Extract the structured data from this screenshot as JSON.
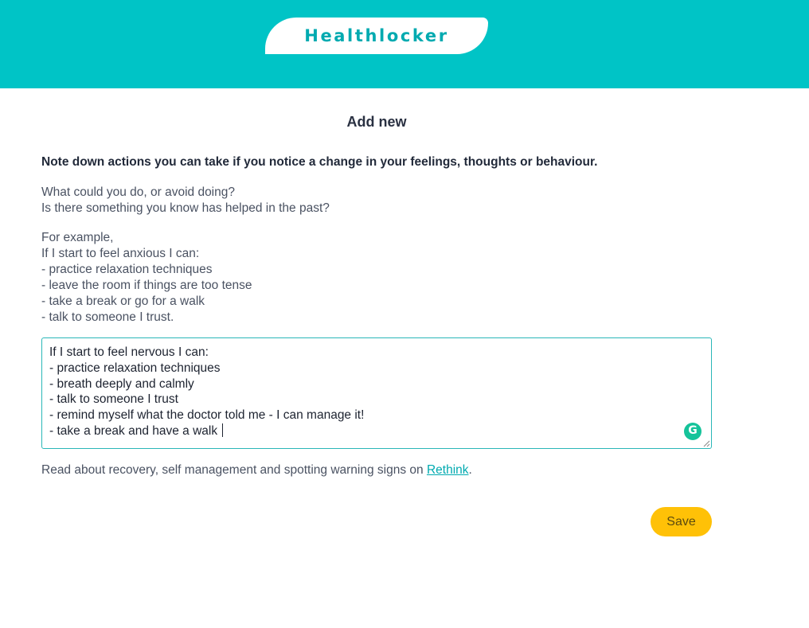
{
  "header": {
    "logo_text": "Healthlocker",
    "background_color": "#00c4c6"
  },
  "main": {
    "title": "Add new",
    "intro": "Note down actions you can take if you notice a change in your feelings, thoughts or behaviour.",
    "questions": [
      "What could you do, or avoid doing?",
      "Is there something you know has helped in the past?"
    ],
    "example": [
      "For example,",
      "If I start to feel anxious I can:",
      "- practice relaxation techniques",
      "- leave the room if things are too tense",
      "- take a break or go for a walk",
      "- talk to someone I trust."
    ],
    "editor": {
      "lines": [
        "If I start to feel nervous I can:",
        "- practice relaxation techniques",
        "- breath deeply and calmly",
        "- talk to someone I trust",
        "- remind myself what the doctor told me - I can manage it!",
        "- take a break and have a walk "
      ],
      "grammarly_badge": "G",
      "border_color": "#2ab7b8"
    },
    "read_about": {
      "prefix": "Read about recovery, self management and spotting warning signs on ",
      "link_text": "Rethink",
      "suffix": "."
    },
    "save_label": "Save",
    "save_color": "#ffc107"
  },
  "icons": {
    "grammarly": "grammarly-icon",
    "resize": "resize-handle-icon"
  }
}
